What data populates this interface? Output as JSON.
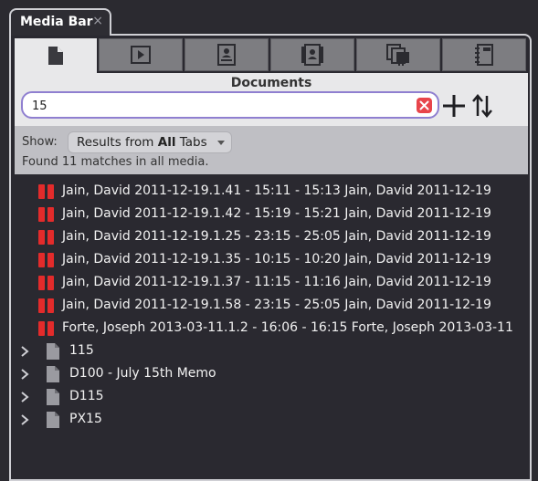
{
  "window_tab": {
    "title": "Media Bar",
    "close": "×"
  },
  "icon_tabs": [
    {
      "icon": "document-icon",
      "active": true
    },
    {
      "icon": "play-video-icon",
      "active": false
    },
    {
      "icon": "transcript-icon",
      "active": false
    },
    {
      "icon": "exhibit-icon",
      "active": false
    },
    {
      "icon": "clips-stack-icon",
      "active": false
    },
    {
      "icon": "notebook-icon",
      "active": false
    }
  ],
  "section": {
    "title": "Documents"
  },
  "search": {
    "value": "15"
  },
  "filter": {
    "show_label": "Show:",
    "select_prefix": "Results from ",
    "select_bold": "All",
    "select_suffix": " Tabs",
    "found_text": "Found 11 matches in all media."
  },
  "results": [
    {
      "text": "Jain, David 2011-12-19.1.41 - 15:11 - 15:13 Jain, David 2011-12-19"
    },
    {
      "text": "Jain, David 2011-12-19.1.42 - 15:19 - 15:21 Jain, David 2011-12-19"
    },
    {
      "text": "Jain, David 2011-12-19.1.25 - 23:15 - 25:05 Jain, David 2011-12-19"
    },
    {
      "text": "Jain, David 2011-12-19.1.35 - 10:15 - 10:20 Jain, David 2011-12-19"
    },
    {
      "text": "Jain, David 2011-12-19.1.37 - 11:15 - 11:16 Jain, David 2011-12-19"
    },
    {
      "text": "Jain, David 2011-12-19.1.58 - 23:15 - 25:05 Jain, David 2011-12-19"
    },
    {
      "text": "Forte, Joseph 2013-03-11.1.2 - 16:06 - 16:15 Forte, Joseph 2013-03-11"
    }
  ],
  "documents": [
    {
      "name": "115"
    },
    {
      "name": "D100 - July 15th Memo"
    },
    {
      "name": "D115"
    },
    {
      "name": "PX15"
    }
  ],
  "colors": {
    "clip_red": "#e32b2b",
    "search_border": "#8f7fd0",
    "clear_red": "#e8454b"
  }
}
